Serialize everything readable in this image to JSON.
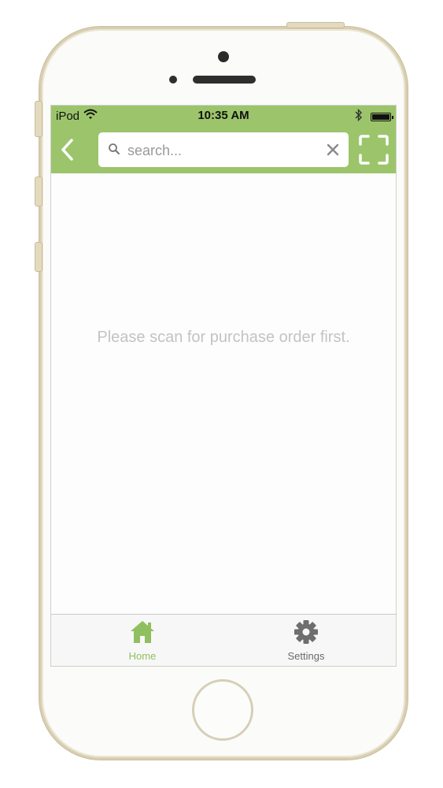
{
  "status_bar": {
    "carrier": "iPod",
    "time": "10:35 AM",
    "wifi_icon": "wifi-icon",
    "bluetooth_icon": "bluetooth-icon",
    "battery_icon": "battery-icon"
  },
  "nav_bar": {
    "back_icon": "chevron-left-icon",
    "search": {
      "placeholder": "search...",
      "value": ""
    },
    "clear_icon": "close-icon",
    "scan_icon": "scan-frame-icon"
  },
  "main": {
    "empty_message": "Please scan for purchase order first."
  },
  "tab_bar": {
    "tabs": [
      {
        "label": "Home",
        "icon": "home-icon",
        "active": true
      },
      {
        "label": "Settings",
        "icon": "gear-icon",
        "active": false
      }
    ]
  },
  "colors": {
    "accent": "#9cc56b",
    "active_tab": "#8fbf5e",
    "inactive_tab": "#6a6a6a",
    "empty_text": "#c3c3c7"
  }
}
